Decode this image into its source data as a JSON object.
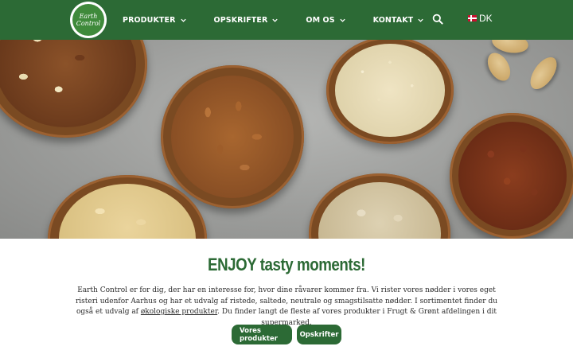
{
  "header": {
    "logo_text": [
      "Earth",
      "Control"
    ],
    "nav": [
      {
        "label": "PRODUKTER"
      },
      {
        "label": "OPSKRIFTER"
      },
      {
        "label": "OM OS"
      },
      {
        "label": "KONTAKT"
      }
    ],
    "language": "DK",
    "colors": {
      "brand_green": "#2c6a35"
    }
  },
  "main": {
    "heading": "ENJOY tasty moments!",
    "intro_before_link": "Earth Control er for dig, der har en interesse for, hvor dine råvarer kommer fra. Vi rister vores nødder i vores eget risteri udenfor Aarhus og har et udvalg af ristede, saltede, neutrale og smagstilsatte nødder. I sortimentet finder du også et udvalg af ",
    "intro_link": "økologiske produkter",
    "intro_after_link": ". Du finder langt de fleste af vores produkter i Frugt & Grønt afdelingen i dit supermarked.",
    "buttons": [
      {
        "label": "Vores produkter"
      },
      {
        "label": "Opskrifter"
      }
    ]
  }
}
